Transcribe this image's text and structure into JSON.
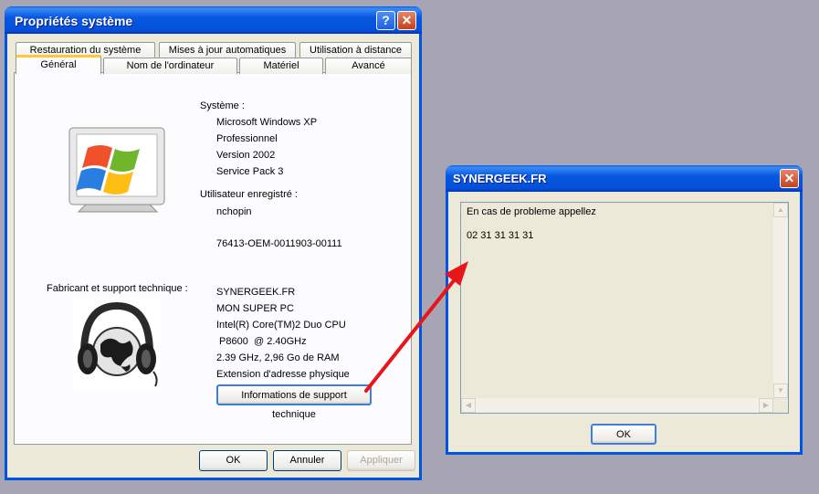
{
  "main_dialog": {
    "title": "Propriétés système",
    "help_glyph": "?",
    "close_glyph": "✕",
    "tabs_top": [
      "Restauration du système",
      "Mises à jour automatiques",
      "Utilisation à distance"
    ],
    "tabs_bottom": [
      "Général",
      "Nom de l'ordinateur",
      "Matériel",
      "Avancé"
    ],
    "system_label": "Système :",
    "system_lines": [
      "Microsoft Windows XP",
      "Professionnel",
      "Version 2002",
      "Service Pack 3"
    ],
    "user_label": "Utilisateur enregistré :",
    "user_name": "nchopin",
    "product_id": "76413-OEM-0011903-00111",
    "manufacturer_label": "Fabricant et support technique :",
    "manufacturer_lines": [
      "SYNERGEEK.FR",
      "MON SUPER PC",
      "Intel(R) Core(TM)2 Duo CPU",
      " P8600  @ 2.40GHz",
      "2.39 GHz, 2,96 Go de RAM",
      "Extension d'adresse physique"
    ],
    "support_button": "Informations de support technique",
    "ok_button": "OK",
    "cancel_button": "Annuler",
    "apply_button": "Appliquer"
  },
  "support_dialog": {
    "title": "SYNERGEEK.FR",
    "close_glyph": "✕",
    "line1": "En cas de probleme appellez",
    "line2": "02 31 31 31 31",
    "ok_button": "OK"
  },
  "colors": {
    "title_blue": "#0054e3",
    "close_red": "#c6401b",
    "arrow_red": "#e8151b",
    "tab_highlight": "#ffc83c"
  }
}
